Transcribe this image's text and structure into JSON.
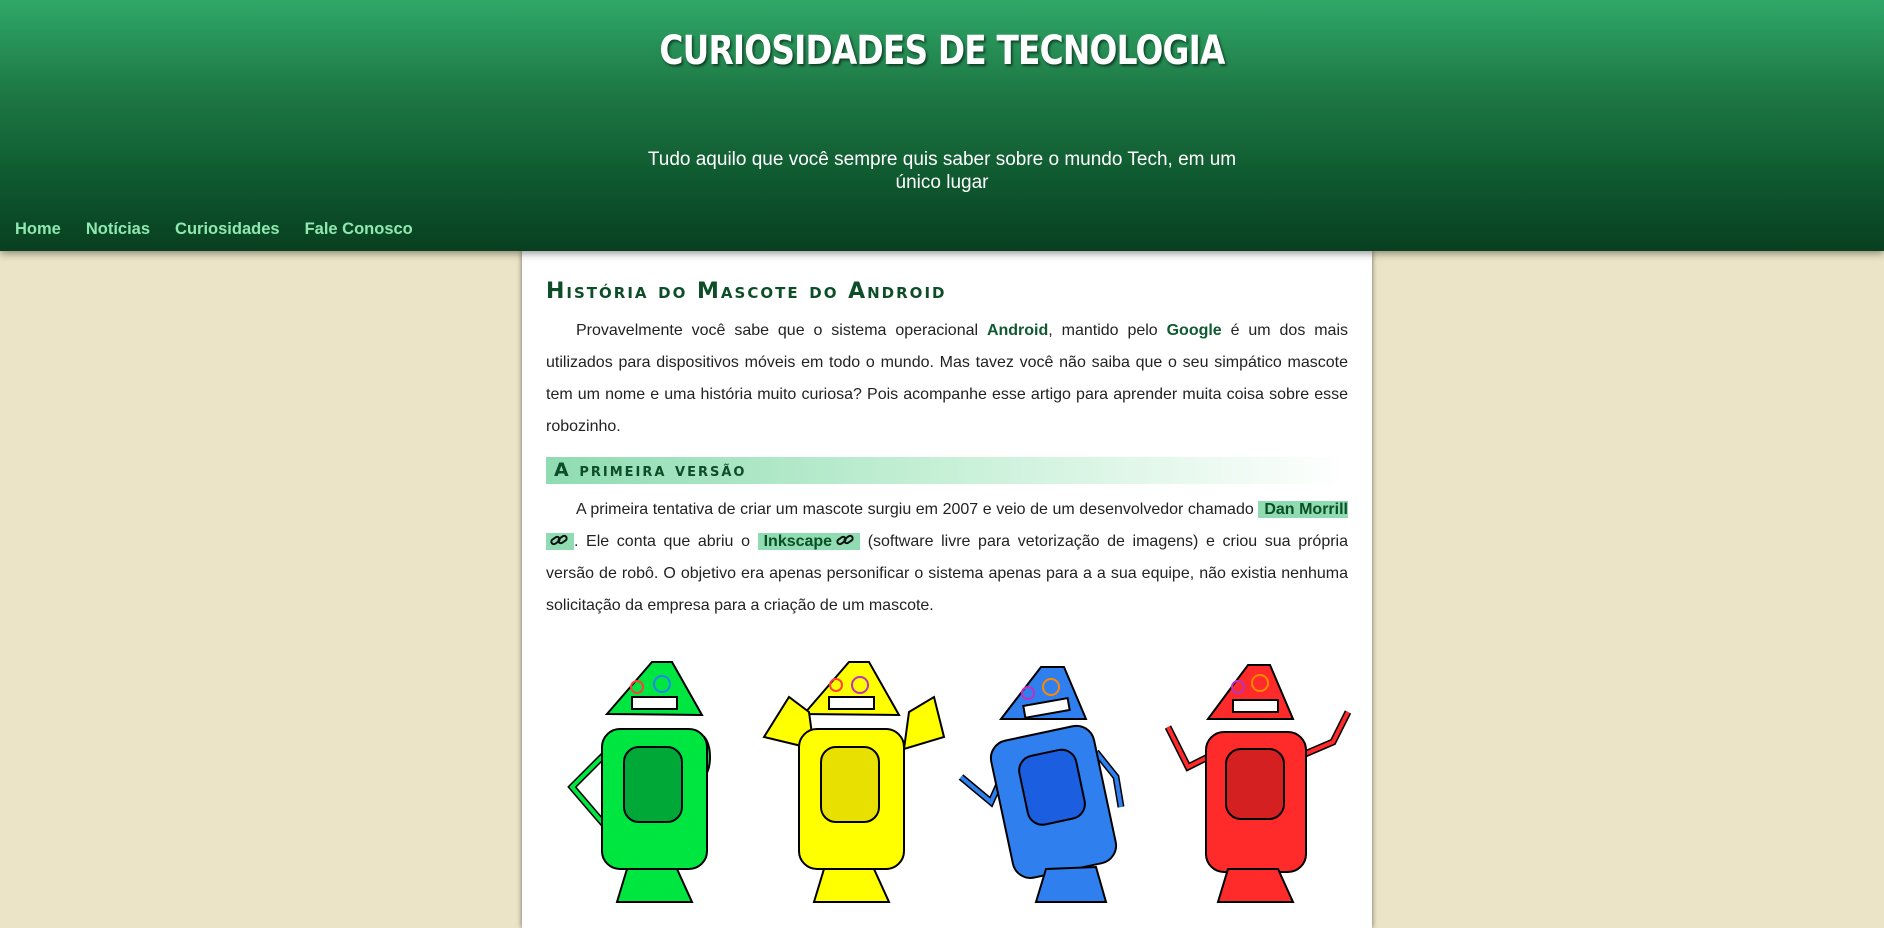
{
  "header": {
    "title": "CURIOSIDADES DE TECNOLOGIA",
    "subtitle": "Tudo aquilo que você sempre quis saber sobre o mundo Tech, em um único lugar"
  },
  "nav": {
    "items": [
      {
        "label": "Home"
      },
      {
        "label": "Notícias"
      },
      {
        "label": "Curiosidades"
      },
      {
        "label": "Fale Conosco"
      }
    ]
  },
  "article": {
    "title": "História do Mascote do Android",
    "intro": {
      "t1": "Provavelmente você sabe que o sistema operacional ",
      "android": "Android",
      "t2": ", mantido pelo ",
      "google": "Google",
      "t3": " é um dos mais utilizados para dispositivos móveis em todo o mundo. Mas tavez você não saiba que o seu simpático mascote tem um nome e uma história muito curiosa? Pois acompanhe esse artigo para aprender muita coisa sobre esse robozinho."
    },
    "section1": {
      "heading": "A primeira versão",
      "t1": "A primeira tentativa de criar um mascote surgiu em 2007 e veio de um desenvolvedor chamado ",
      "link1": "Dan Morrill",
      "t2": ". Ele conta que abriu o ",
      "link2": "Inkscape",
      "t3": " (software livre para vetorização de imagens) e criou sua própria versão de robô. O objetivo era apenas personificar o sistema apenas para a a sua equipe, não existia nenhuma solicitação da empresa para a criação de um mascote."
    },
    "robots": [
      {
        "color": "#00e640",
        "name": "green-robot"
      },
      {
        "color": "#ffff00",
        "name": "yellow-robot"
      },
      {
        "color": "#2f7fef",
        "name": "blue-robot"
      },
      {
        "color": "#ff2a2a",
        "name": "red-robot"
      }
    ]
  },
  "colors": {
    "header_top": "#2fa868",
    "header_bottom": "#083f20",
    "nav_link": "#8ee8b0",
    "page_bg": "#ebe4c6",
    "highlight": "#8fdcb2",
    "heading": "#0d4d27"
  }
}
